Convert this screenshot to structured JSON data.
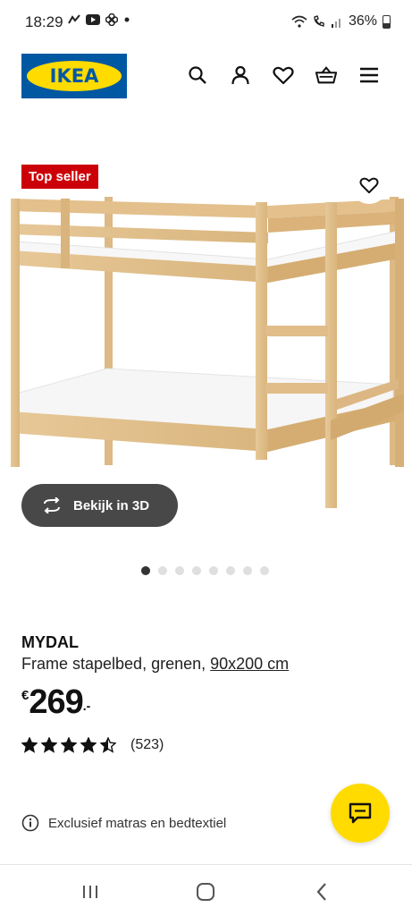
{
  "status_bar": {
    "time": "18:29",
    "battery": "36%",
    "notification_icons": [
      "missed-call-icon",
      "youtube-icon",
      "fan-icon",
      "dot-icon"
    ],
    "system_icons": [
      "wifi-icon",
      "call-icon",
      "signal-icon",
      "battery-icon"
    ]
  },
  "header": {
    "logo_text": "IKEA",
    "icons": [
      "search-icon",
      "user-icon",
      "heart-icon",
      "basket-icon",
      "menu-icon"
    ],
    "colors": {
      "logo_blue": "#0058a3",
      "logo_yellow": "#ffdb00"
    }
  },
  "product_image": {
    "badge": "Top seller",
    "view_3d_label": "Bekijk in 3D",
    "carousel": {
      "total": 8,
      "active": 0
    }
  },
  "product": {
    "name": "MYDAL",
    "description": "Frame stapelbed, grenen, ",
    "size": "90x200 cm",
    "price_currency": "€",
    "price_amount": "269",
    "price_decimals": ".-",
    "rating": 4.5,
    "rating_max": 5,
    "review_count": "(523)",
    "info_note": "Exclusief matras en bedtextiel"
  },
  "colors": {
    "badge_red": "#cc0008",
    "fab_yellow": "#ffdb00",
    "button_dark": "#484848"
  },
  "nav_bar": {
    "buttons": [
      "recent-apps-icon",
      "home-icon",
      "back-icon"
    ]
  }
}
